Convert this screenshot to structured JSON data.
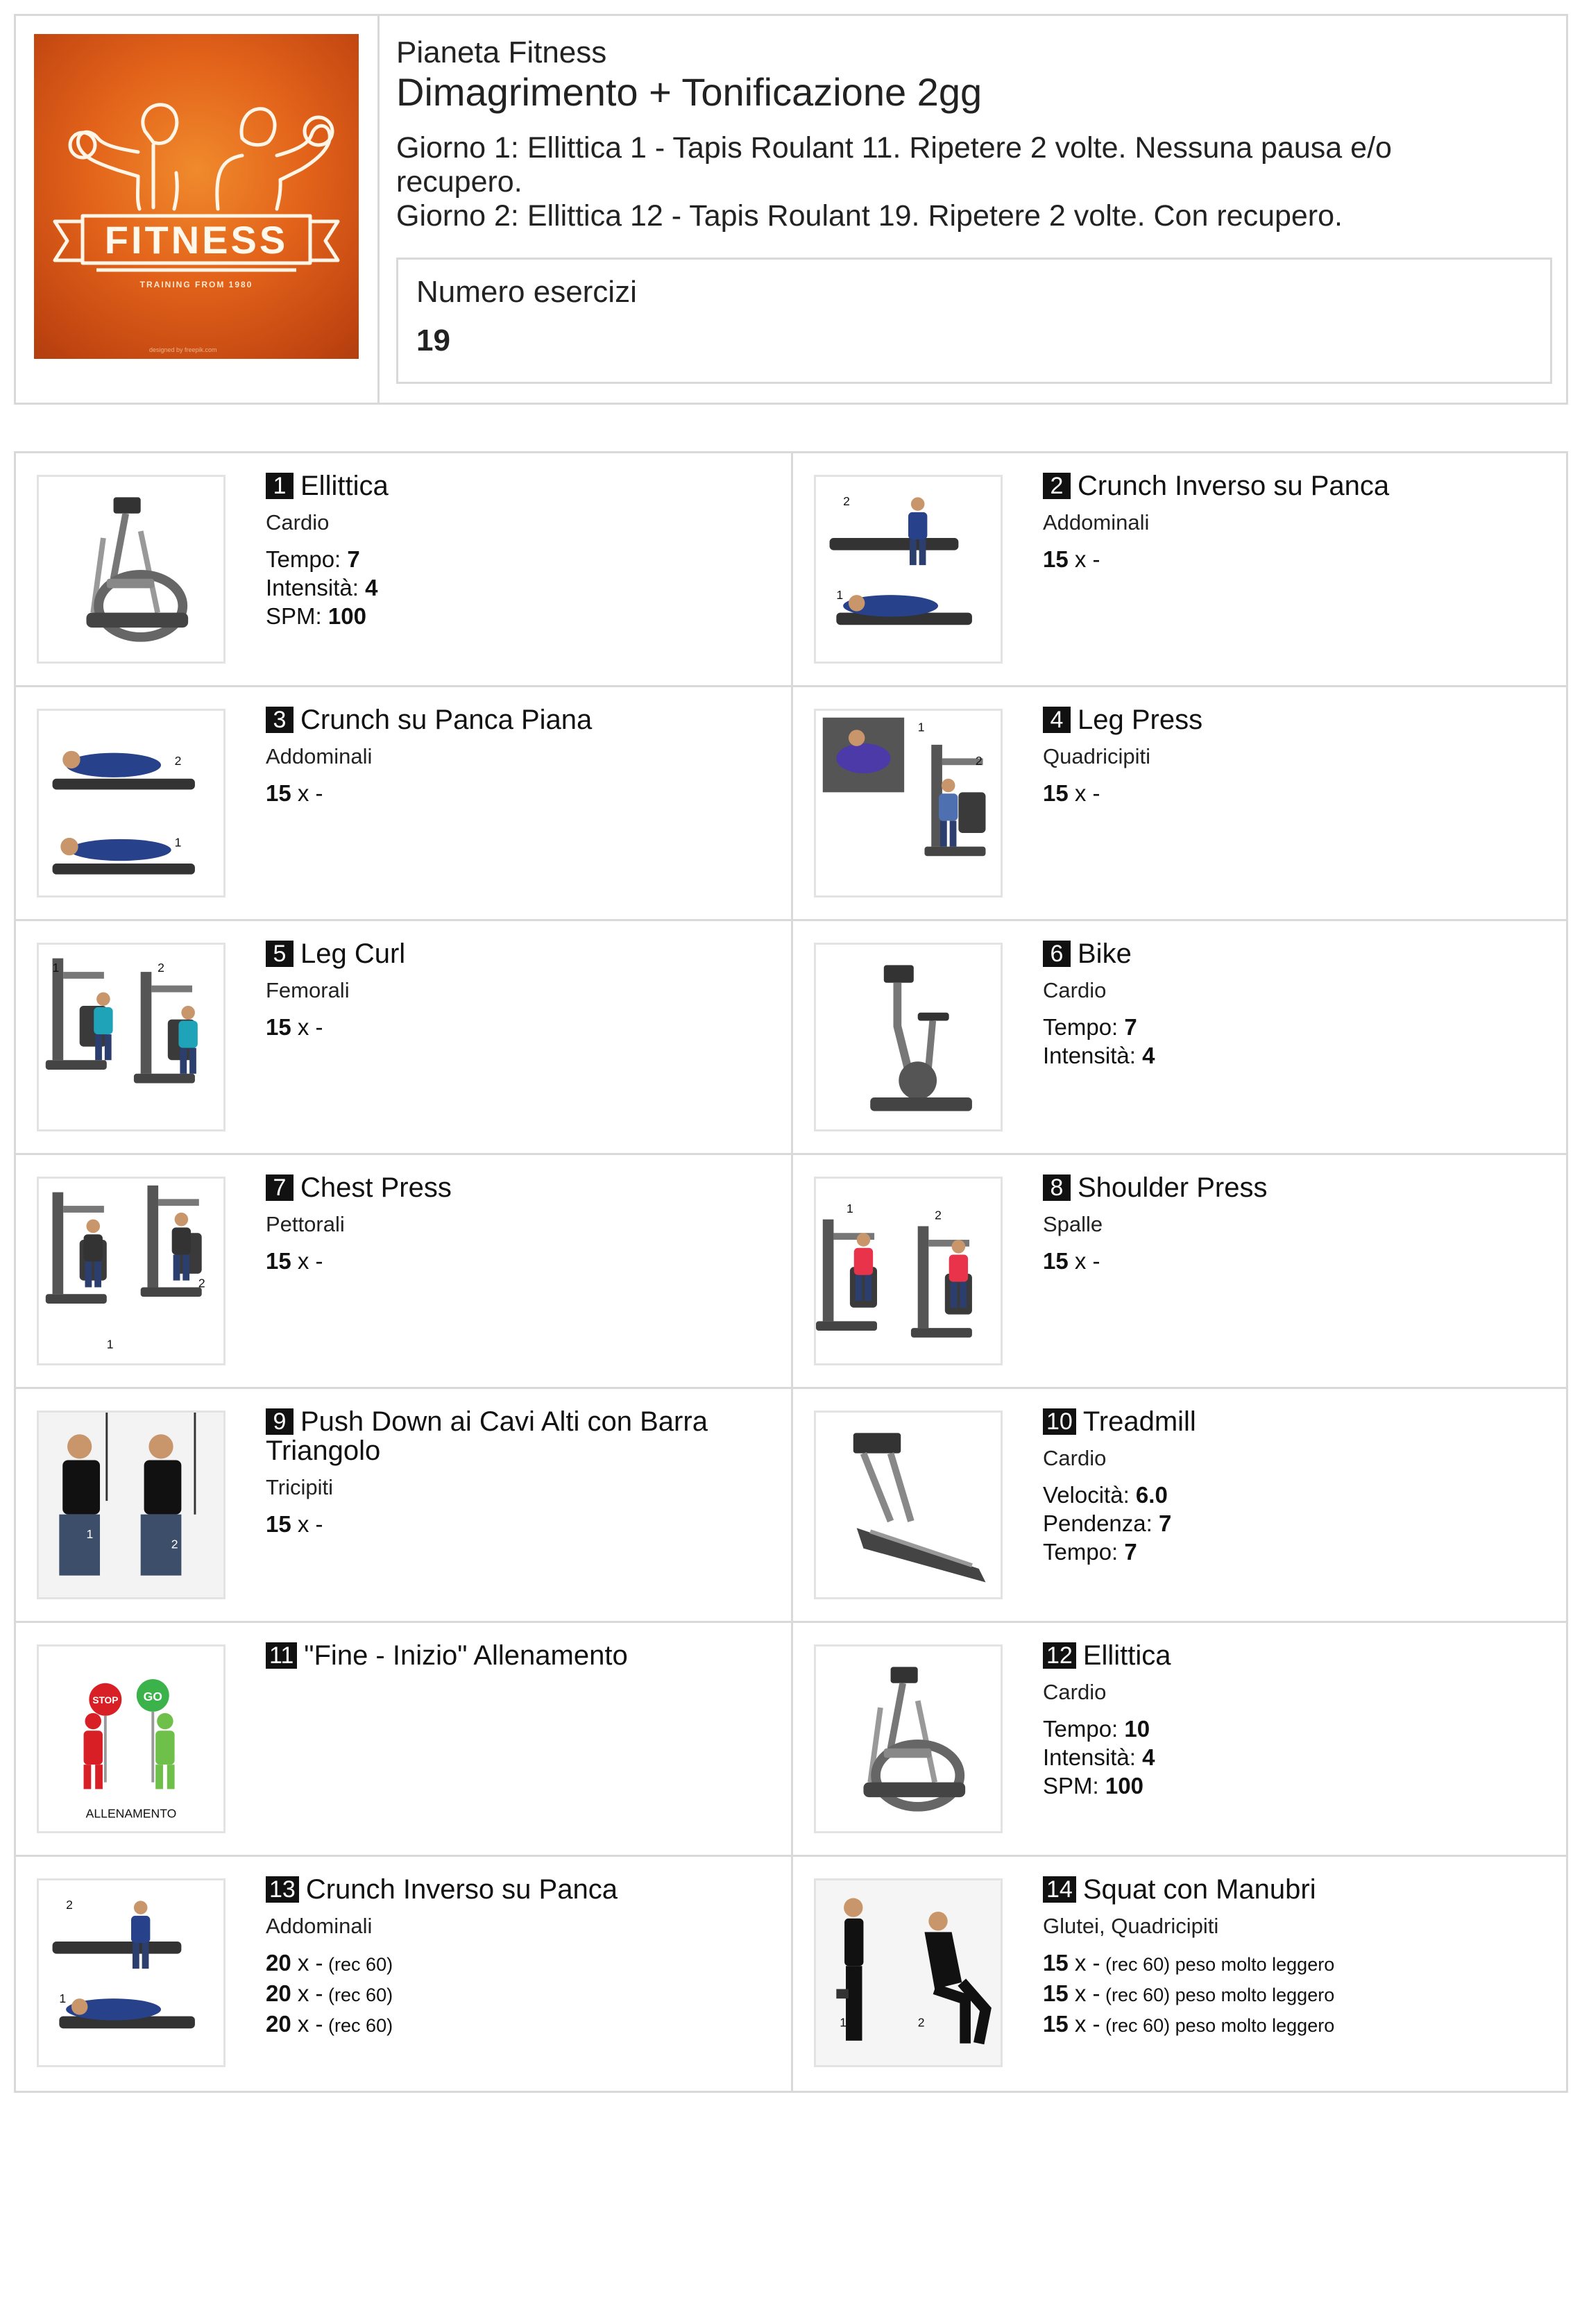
{
  "header": {
    "brand": "Pianeta Fitness",
    "title": "Dimagrimento + Tonificazione 2gg",
    "day1": "Giorno 1: Ellittica 1 - Tapis Roulant 11. Ripetere 2 volte. Nessuna pausa e/o recupero.",
    "day2": "Giorno 2: Ellittica 12 - Tapis Roulant 19. Ripetere 2 volte. Con recupero.",
    "count_label": "Numero esercizi",
    "count_value": "19",
    "logo": {
      "text": "FITNESS",
      "subtitle": "TRAINING FROM 1980",
      "credit": "designed by freepik.com"
    }
  },
  "exercises": [
    {
      "num": "1",
      "name": "Ellittica",
      "muscle": "Cardio",
      "icon": "elliptical-icon",
      "params": [
        {
          "label": "Tempo: ",
          "value": "7"
        },
        {
          "label": "Intensità: ",
          "value": "4"
        },
        {
          "label": "SPM: ",
          "value": "100"
        }
      ]
    },
    {
      "num": "2",
      "name": "Crunch Inverso su Panca",
      "muscle": "Addominali",
      "icon": "reverse-crunch-icon",
      "params": [
        {
          "value": "15",
          "label": " x -"
        }
      ]
    },
    {
      "num": "3",
      "name": "Crunch su Panca Piana",
      "muscle": "Addominali",
      "icon": "crunch-icon",
      "params": [
        {
          "value": "15",
          "label": " x -"
        }
      ]
    },
    {
      "num": "4",
      "name": "Leg Press",
      "muscle": "Quadricipiti",
      "icon": "leg-press-icon",
      "params": [
        {
          "value": "15",
          "label": " x -"
        }
      ]
    },
    {
      "num": "5",
      "name": "Leg Curl",
      "muscle": "Femorali",
      "icon": "leg-curl-icon",
      "params": [
        {
          "value": "15",
          "label": " x -"
        }
      ]
    },
    {
      "num": "6",
      "name": "Bike",
      "muscle": "Cardio",
      "icon": "exercise-bike-icon",
      "params": [
        {
          "label": "Tempo: ",
          "value": "7"
        },
        {
          "label": "Intensità: ",
          "value": "4"
        }
      ]
    },
    {
      "num": "7",
      "name": "Chest Press",
      "muscle": "Pettorali",
      "icon": "chest-press-icon",
      "params": [
        {
          "value": "15",
          "label": " x -"
        }
      ]
    },
    {
      "num": "8",
      "name": "Shoulder Press",
      "muscle": "Spalle",
      "icon": "shoulder-press-icon",
      "params": [
        {
          "value": "15",
          "label": " x -"
        }
      ]
    },
    {
      "num": "9",
      "name": "Push Down ai Cavi Alti con Barra Triangolo",
      "muscle": "Tricipiti",
      "icon": "cable-pushdown-icon",
      "params": [
        {
          "value": "15",
          "label": " x -"
        }
      ]
    },
    {
      "num": "10",
      "name": "Treadmill",
      "muscle": "Cardio",
      "icon": "treadmill-icon",
      "params": [
        {
          "label": "Velocità: ",
          "value": "6.0"
        },
        {
          "label": "Pendenza: ",
          "value": "7"
        },
        {
          "label": "Tempo: ",
          "value": "7"
        }
      ]
    },
    {
      "num": "11",
      "name": "\"Fine - Inizio\" Allenamento",
      "muscle": "",
      "icon": "stop-go-icon",
      "caption": "ALLENAMENTO",
      "params": []
    },
    {
      "num": "12",
      "name": "Ellittica",
      "muscle": "Cardio",
      "icon": "elliptical-icon",
      "params": [
        {
          "label": "Tempo: ",
          "value": "10"
        },
        {
          "label": "Intensità: ",
          "value": "4"
        },
        {
          "label": "SPM: ",
          "value": "100"
        }
      ]
    },
    {
      "num": "13",
      "name": "Crunch Inverso su Panca",
      "muscle": "Addominali",
      "icon": "reverse-crunch-icon",
      "params": [
        {
          "value": "20",
          "label": " x -",
          "note": " (rec 60)"
        },
        {
          "value": "20",
          "label": " x -",
          "note": " (rec 60)"
        },
        {
          "value": "20",
          "label": " x -",
          "note": " (rec 60)"
        }
      ]
    },
    {
      "num": "14",
      "name": "Squat con Manubri",
      "muscle": "Glutei, Quadricipiti",
      "icon": "dumbbell-squat-icon",
      "params": [
        {
          "value": "15",
          "label": " x -",
          "note": " (rec 60)",
          "extra": " peso molto leggero"
        },
        {
          "value": "15",
          "label": " x -",
          "note": " (rec 60)",
          "extra": " peso molto leggero"
        },
        {
          "value": "15",
          "label": " x -",
          "note": " (rec 60)",
          "extra": " peso molto leggero"
        }
      ]
    }
  ]
}
